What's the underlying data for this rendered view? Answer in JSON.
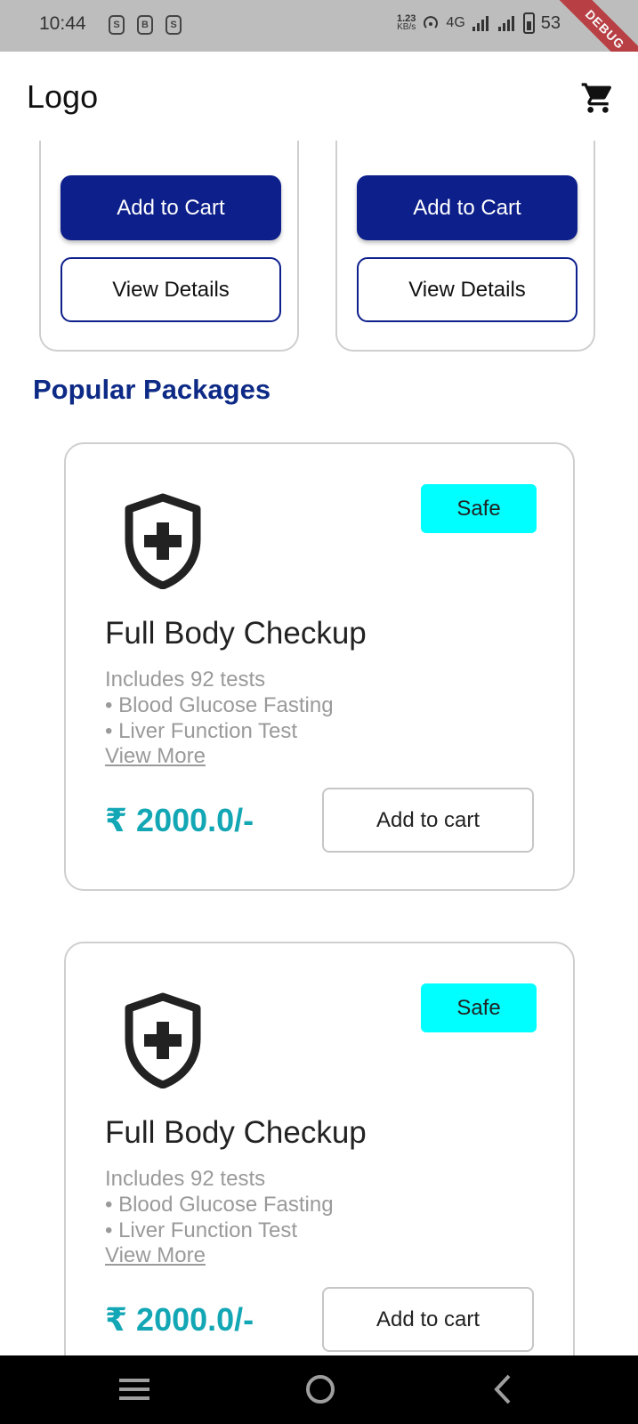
{
  "status_bar": {
    "time": "10:44",
    "notification_icons": [
      "S",
      "B",
      "S"
    ],
    "net_speed_value": "1.23",
    "net_speed_unit": "KB/s",
    "network": "4G",
    "battery_percent": "53"
  },
  "debug_banner": "DEBUG",
  "app_bar": {
    "logo": "Logo"
  },
  "top_cards": [
    {
      "add_to_cart": "Add to Cart",
      "view_details": "View Details"
    },
    {
      "add_to_cart": "Add to Cart",
      "view_details": "View Details"
    }
  ],
  "section_title": "Popular Packages",
  "packages": [
    {
      "badge": "Safe",
      "title": "Full Body Checkup",
      "includes": "Includes 92 tests",
      "tests": [
        "• Blood Glucose Fasting",
        "• Liver Function Test"
      ],
      "view_more": "View More",
      "price": "₹ 2000.0/-",
      "add_to_cart": "Add to cart"
    },
    {
      "badge": "Safe",
      "title": "Full Body Checkup",
      "includes": "Includes 92 tests",
      "tests": [
        "• Blood Glucose Fasting",
        "• Liver Function Test"
      ],
      "view_more": "View More",
      "price": "₹ 2000.0/-",
      "add_to_cart": "Add to cart"
    }
  ],
  "icons": {
    "cart": "shopping-cart-icon",
    "package": "shield-plus-icon",
    "nav": [
      "menu-icon",
      "home-icon",
      "back-icon"
    ]
  },
  "colors": {
    "primary": "#0d1f8b",
    "title": "#0d2a86",
    "price": "#13a7b5",
    "badge": "#00ffff"
  }
}
